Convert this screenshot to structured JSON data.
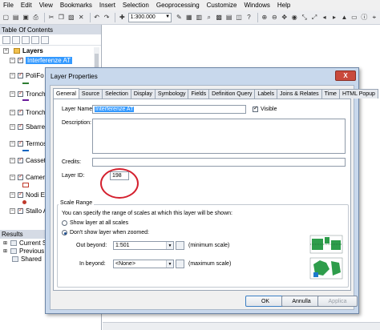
{
  "menu": [
    "File",
    "Edit",
    "View",
    "Bookmarks",
    "Insert",
    "Selection",
    "Geoprocessing",
    "Customize",
    "Windows",
    "Help"
  ],
  "toolbar": {
    "scale_value": "1:300.000"
  },
  "toc": {
    "title": "Table Of Contents",
    "group": "Layers",
    "layers": [
      {
        "label": "Interferenze AT",
        "selected": true
      },
      {
        "label": "PoliFo"
      },
      {
        "label": "Tronchi"
      },
      {
        "label": "Tronchi"
      },
      {
        "label": "Sbarre A"
      },
      {
        "label": "Termos"
      },
      {
        "label": "Cassetti"
      },
      {
        "label": "Camere"
      },
      {
        "label": "Nodi El"
      },
      {
        "label": "Stallo A"
      }
    ]
  },
  "results": {
    "title": "Results",
    "items": [
      "Current Ses",
      "Previous Se",
      "Shared"
    ]
  },
  "dialog": {
    "title": "Layer Properties",
    "close_glyph": "X",
    "tabs": [
      "General",
      "Source",
      "Selection",
      "Display",
      "Symbology",
      "Fields",
      "Definition Query",
      "Labels",
      "Joins & Relates",
      "Time",
      "HTML Popup"
    ],
    "active_tab": "General",
    "layer_name_label": "Layer Name:",
    "layer_name_value": "Interferenze AT",
    "visible_label": "Visible",
    "description_label": "Description:",
    "credits_label": "Credits:",
    "layer_id_label": "Layer ID:",
    "layer_id_value": "198",
    "scale_range": {
      "legend": "Scale Range",
      "help_text": "You can specify the range of scales at which this layer will be shown:",
      "option_all": "Show layer at all scales",
      "option_dont": "Don't show layer when zoomed:",
      "out_beyond_label": "Out beyond:",
      "out_beyond_value": "1:501",
      "out_beyond_hint": "(minimum scale)",
      "in_beyond_label": "In beyond:",
      "in_beyond_value": "<None>",
      "in_beyond_hint": "(maximum scale)"
    },
    "buttons": {
      "ok": "OK",
      "cancel": "Annulla",
      "apply": "Applica"
    }
  }
}
